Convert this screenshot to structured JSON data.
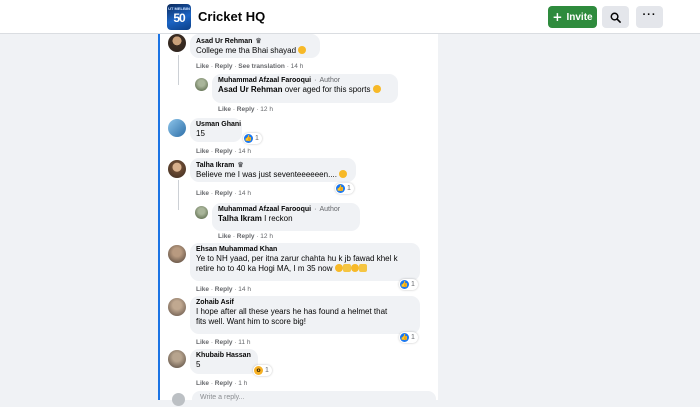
{
  "header": {
    "group_name": "Cricket HQ",
    "logo_text": "50",
    "logo_strip": "UT MELBIN",
    "invite_label": "Invite",
    "search_icon": "search-icon",
    "more_icon": "more-options-icon"
  },
  "colors": {
    "accent": "#1b74e4",
    "invite_green": "#2e8b3d",
    "like_blue": "#1877f2",
    "bubble_bg": "#f0f2f5",
    "meta_gray": "#65676b"
  },
  "comments": [
    {
      "author": "Asad Ur Rehman",
      "badge_icon": "top-fan-icon",
      "text": "College me tha Bhai shayad",
      "emoji": "laughing-emoji",
      "like": "Like",
      "reply": "Reply",
      "extra": "See translation",
      "time": "14 h"
    },
    {
      "author": "Muhammad Afzaal Farooqui",
      "badge": "Author",
      "tag": "Asad Ur Rehman",
      "text": " over aged for this sports",
      "emoji": "smile-emoji",
      "like": "Like",
      "reply": "Reply",
      "time": "12 h"
    },
    {
      "author": "Usman Ghani",
      "text": "15",
      "reactions": "1",
      "reaction_icon": "like-icon",
      "like": "Like",
      "reply": "Reply",
      "time": "14 h"
    },
    {
      "author": "Talha Ikram",
      "badge_icon": "top-fan-icon",
      "text": "Believe me I was just seventeeeeeen....",
      "emoji": "laughing-emoji",
      "reactions": "1",
      "reaction_icon": "like-icon",
      "like": "Like",
      "reply": "Reply",
      "time": "14 h"
    },
    {
      "author": "Muhammad Afzaal Farooqui",
      "badge": "Author",
      "tag": "Talha Ikram",
      "text": " I reckon",
      "like": "Like",
      "reply": "Reply",
      "time": "12 h"
    },
    {
      "author": "Ehsan Muhammad Khan",
      "text_line1": "Ye to NH yaad, per itna zarur chahta hu k jb fawad khel k",
      "text_line2": "retire ho to 40 ka Hogi MA, I m 35 now",
      "emoji_row": "sunglasses-thumbsup-emojis",
      "reactions": "1",
      "reaction_icon": "like-icon",
      "like": "Like",
      "reply": "Reply",
      "time": "14 h"
    },
    {
      "author": "Zohaib Asif",
      "text_line1": "I hope after all these years he has found a helmet that",
      "text_line2": "fits well. Want him to score big!",
      "reactions": "1",
      "reaction_icon": "like-icon",
      "like": "Like",
      "reply": "Reply",
      "time": "11 h"
    },
    {
      "author": "Khubaib Hassan",
      "text": "5",
      "reactions": "1",
      "reaction_icon": "wow-icon",
      "like": "Like",
      "reply": "Reply",
      "time": "1 h"
    }
  ],
  "composer": {
    "placeholder": "Write a reply..."
  }
}
